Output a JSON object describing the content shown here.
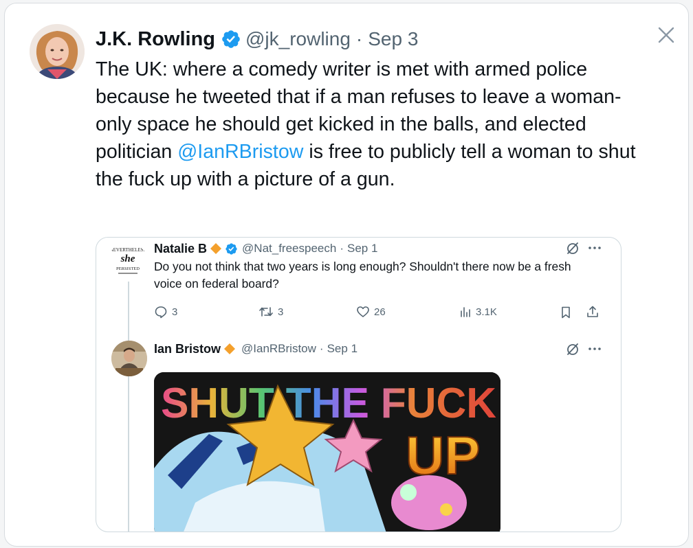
{
  "tweet": {
    "author_name": "J.K. Rowling",
    "author_handle": "@jk_rowling",
    "separator": "·",
    "date": "Sep 3",
    "text_part1": "The UK: where a comedy writer is met with armed police because he tweeted that if a man refuses to leave a woman-only space he should get kicked in the balls, and elected politician ",
    "mention": "@IanRBristow",
    "text_part2": " is free to publicly tell a woman to shut the fuck up with a picture of a gun."
  },
  "quote": {
    "first": {
      "name": "Natalie B",
      "handle": "@Nat_freespeech",
      "separator": "·",
      "date": "Sep 1",
      "text": "Do you not think that two years is long enough? Shouldn't there now be a fresh voice on federal board?",
      "replies": "3",
      "retweets": "3",
      "likes": "26",
      "views": "3.1K"
    },
    "second": {
      "name": "Ian Bristow",
      "handle": "@IanRBristow",
      "separator": "·",
      "date": "Sep 1",
      "media_text_line1": "SHUT THE FUCK",
      "media_text_line2": "UP"
    }
  },
  "avatar_text": {
    "top": "NEVERTHELESS",
    "middle": "she",
    "bottom": "PERSISTED"
  },
  "icons": {
    "close": "close-icon",
    "verified": "verified-badge-icon",
    "affiliate": "orange-diamond-icon",
    "reply": "reply-icon",
    "retweet": "retweet-icon",
    "like": "heart-icon",
    "views": "views-icon",
    "bookmark": "bookmark-icon",
    "share": "share-icon",
    "grok": "slashed-circle-icon",
    "more": "more-icon"
  },
  "colors": {
    "link": "#1d9bf0",
    "text": "#0f1419",
    "secondary": "#536471",
    "verified": "#1d9bf0",
    "affiliate": "#f4a02c"
  }
}
